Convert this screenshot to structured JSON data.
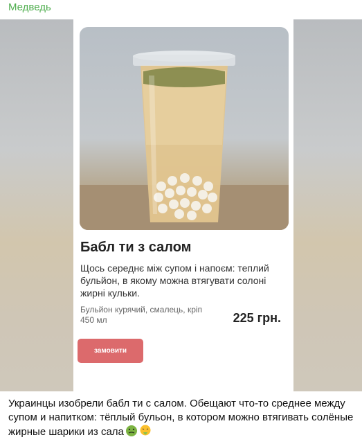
{
  "post": {
    "channel_name": "Медведь",
    "caption": "Украинцы изобрели бабл ти с салом. Обещают что-то среднее между супом и напитком: тёплый бульон, в котором можно втягивать солёные жирные шарики из сала",
    "emojis": [
      "nauseated-face-icon",
      "vomiting-face-icon"
    ]
  },
  "card": {
    "title": "Бабл ти з салом",
    "description": "Щось середнє між супом і напоєм: теплий бульйон, в якому можна втягувати солоні жирні кульки.",
    "ingredients": "Бульйон курячий, смалець, кріп",
    "volume": "450 мл",
    "price": "225 грн.",
    "order_button": "замовити"
  },
  "colors": {
    "channel_name": "#4fae4e",
    "button": "#dc6a6c"
  }
}
